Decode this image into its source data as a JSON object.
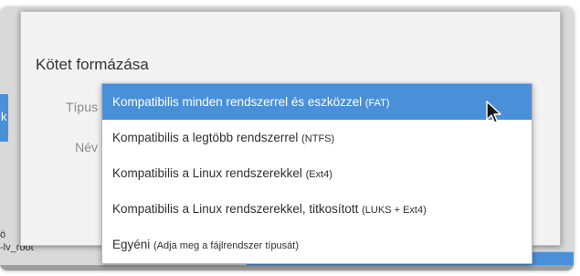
{
  "background": {
    "left_accent_glyph": "k",
    "tree_text_line1": "ö",
    "tree_text_line2": "-lv_root"
  },
  "dialog": {
    "title": "Kötet formázása",
    "type_label": "Típus",
    "name_label": "Név"
  },
  "dropdown": {
    "options": [
      {
        "label": "Kompatibilis minden rendszerrel és eszközzel",
        "note": "(FAT)",
        "selected": true
      },
      {
        "label": "Kompatibilis a legtöbb rendszerrel",
        "note": "(NTFS)",
        "selected": false
      },
      {
        "label": "Kompatibilis a Linux rendszerekkel",
        "note": "(Ext4)",
        "selected": false
      },
      {
        "label": "Kompatibilis a Linux rendszerekkel, titkosított",
        "note": "(LUKS + Ext4)",
        "selected": false
      },
      {
        "label": "Egyéni",
        "note": "(Adja meg a fájlrendszer típusát)",
        "selected": false
      }
    ]
  },
  "colors": {
    "accent": "#4a90d9",
    "dialog_bg": "#f2f2f2",
    "label_gray": "#8a8a8a"
  },
  "icons": {
    "cursor": "mouse-pointer-icon"
  }
}
